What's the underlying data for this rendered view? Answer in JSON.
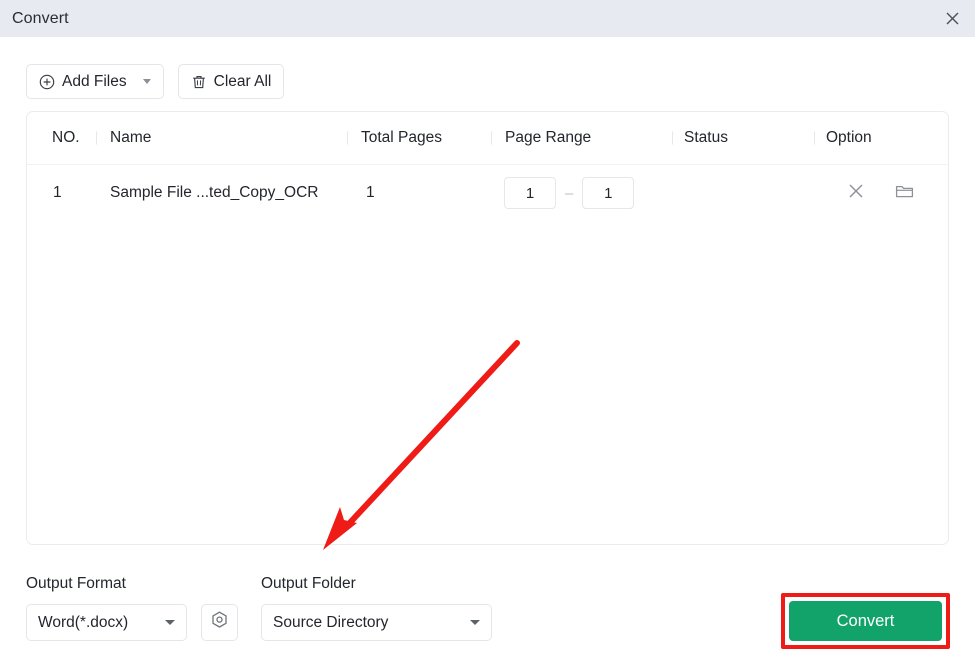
{
  "window": {
    "title": "Convert",
    "close_icon": "close-icon"
  },
  "toolbar": {
    "add_files_label": "Add Files",
    "add_files_icon": "plus-circle-icon",
    "add_files_caret_icon": "chevron-down-icon",
    "clear_all_label": "Clear All",
    "clear_all_icon": "trash-icon"
  },
  "table": {
    "columns": [
      {
        "key": "no",
        "label": "NO."
      },
      {
        "key": "name",
        "label": "Name"
      },
      {
        "key": "total_pages",
        "label": "Total Pages"
      },
      {
        "key": "page_range",
        "label": "Page Range"
      },
      {
        "key": "status",
        "label": "Status"
      },
      {
        "key": "option",
        "label": "Option"
      }
    ],
    "rows": [
      {
        "no": "1",
        "name": "Sample File ...ted_Copy_OCR",
        "total_pages": "1",
        "page_range_from": "1",
        "page_range_to": "1",
        "page_range_separator": "–",
        "status": "",
        "remove_icon": "close-icon",
        "folder_icon": "folder-icon"
      }
    ]
  },
  "bottom": {
    "output_format_label": "Output Format",
    "output_format_value": "Word(*.docx)",
    "output_format_caret_icon": "chevron-down-icon",
    "settings_icon": "settings-hexagon-icon",
    "output_folder_label": "Output Folder",
    "output_folder_value": "Source Directory",
    "output_folder_caret_icon": "chevron-down-icon",
    "convert_label": "Convert"
  },
  "annotations": {
    "arrow_color": "#ee1b16",
    "highlight_color": "#ee1b16"
  },
  "colors": {
    "titlebar_bg": "#e7eaf1",
    "convert_green": "#12a36b",
    "panel_border": "#ebecee",
    "text": "#23262c"
  }
}
